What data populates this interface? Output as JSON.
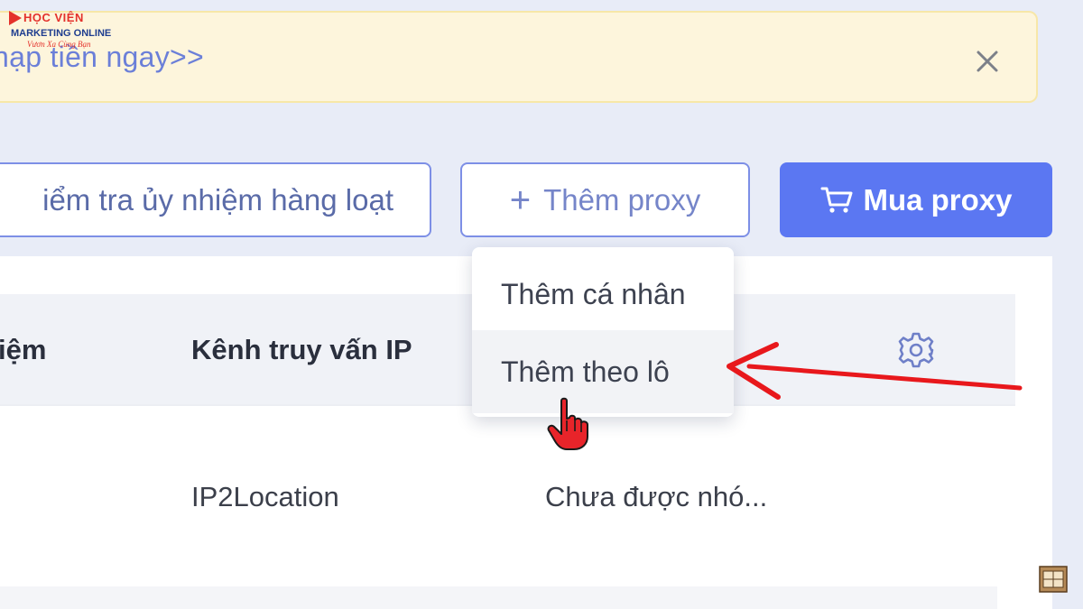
{
  "banner": {
    "text": "nạp tiền ngay>>"
  },
  "toolbar": {
    "bulk_check_label": "iểm tra ủy nhiệm hàng loạt",
    "add_proxy_label": "Thêm proxy",
    "buy_proxy_label": "Mua proxy"
  },
  "table": {
    "headers": [
      "iệm",
      "Kênh truy vấn IP"
    ],
    "rows": [
      {
        "channel": "IP2Location",
        "group": "Chưa được nhó..."
      }
    ]
  },
  "dropdown": {
    "items": [
      {
        "label": "Thêm cá nhân"
      },
      {
        "label": "Thêm theo lô"
      }
    ]
  },
  "logo": {
    "line1": "HỌC VIỆN",
    "line2": "MARKETING ONLINE",
    "line3": "Vươn Xa Cùng Bạn"
  },
  "colors": {
    "accent": "#5b77f2",
    "banner_bg": "#fdf5dc",
    "annotation_arrow": "#e8181c"
  },
  "icons": [
    "close-icon",
    "plus-icon",
    "cart-icon",
    "gear-icon",
    "hand-cursor-icon",
    "arrow-annotation"
  ]
}
